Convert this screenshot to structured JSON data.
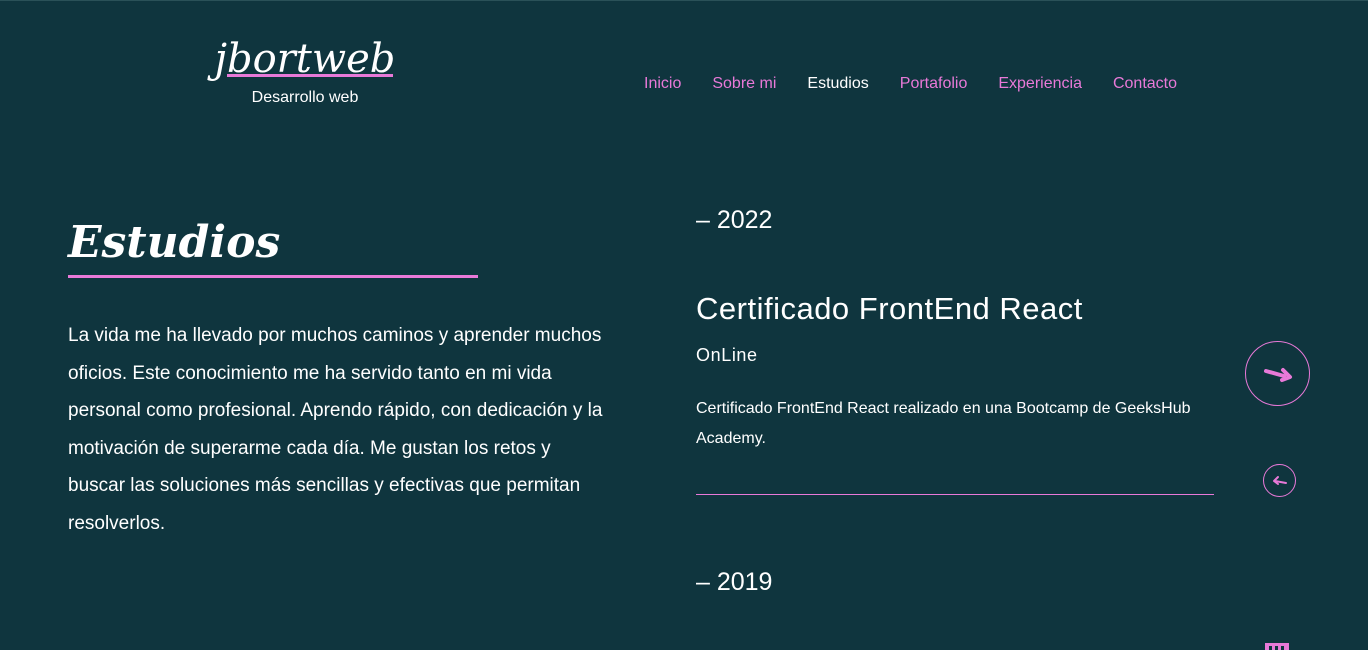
{
  "header": {
    "brand_name": "jbortweb",
    "tagline": "Desarrollo web"
  },
  "nav": {
    "items": [
      {
        "label": "Inicio",
        "active": false
      },
      {
        "label": "Sobre mi",
        "active": false
      },
      {
        "label": "Estudios",
        "active": true
      },
      {
        "label": "Portafolio",
        "active": false
      },
      {
        "label": "Experiencia",
        "active": false
      },
      {
        "label": "Contacto",
        "active": false
      }
    ]
  },
  "section": {
    "title": "Estudios",
    "intro": "La vida me ha llevado por muchos caminos y aprender muchos oficios. Este conocimiento me ha servido tanto en mi vida personal como profesional. Aprendo rápido, con dedicación y la motivación de superarme cada día. Me gustan los retos y buscar las soluciones más sencillas y efectivas que permitan resolverlos."
  },
  "timeline": [
    {
      "year": "– 2022",
      "title": "Certificado FrontEnd React",
      "place": "OnLine",
      "description": "Certificado FrontEnd React realizado en una Bootcamp de GeeksHub Academy."
    },
    {
      "year": "– 2019"
    }
  ],
  "icons": {
    "next": "arrow-right-icon",
    "prev": "arrow-left-icon",
    "calendar": "calendar-icon"
  },
  "colors": {
    "background": "#0f353e",
    "accent": "#e879d8",
    "text": "#ffffff"
  }
}
